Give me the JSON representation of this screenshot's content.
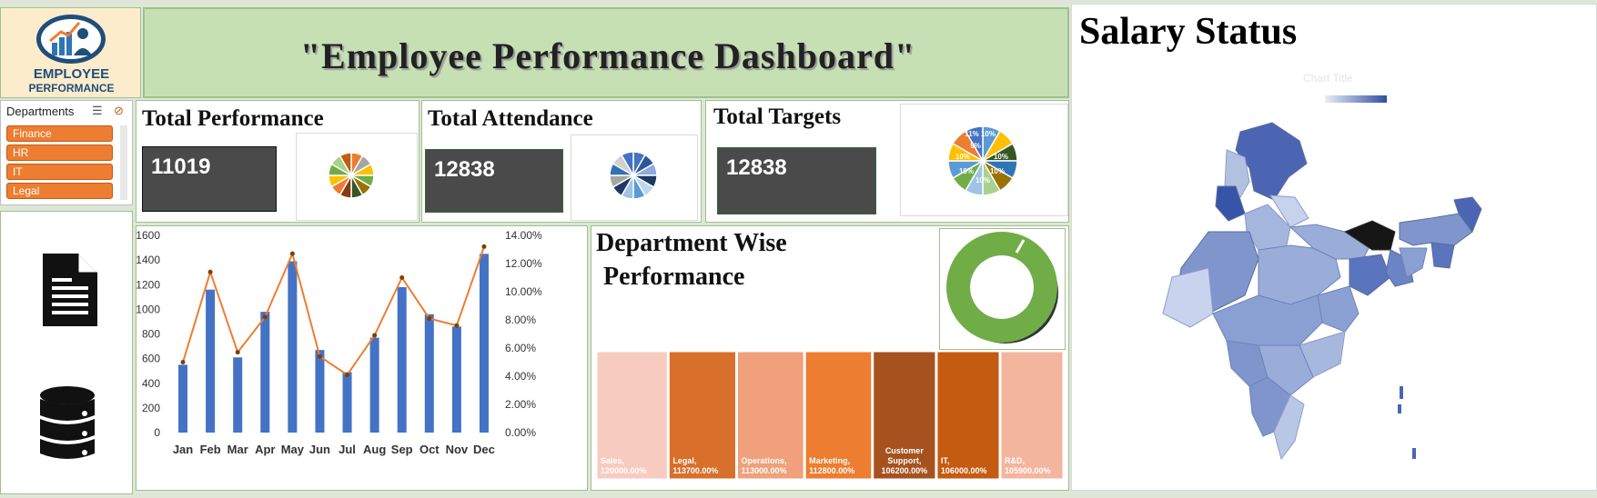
{
  "logo": {
    "line1": "EMPLOYEE",
    "line2": "PERFORMANCE"
  },
  "header": {
    "title": "\"Employee Performance Dashboard\""
  },
  "slicer": {
    "title": "Departments",
    "items": [
      "Finance",
      "HR",
      "IT",
      "Legal"
    ]
  },
  "kpis": {
    "performance": {
      "label": "Total Performance",
      "value": "11019"
    },
    "attendance": {
      "label": "Total Attendance",
      "value": "12838"
    },
    "targets": {
      "label": "Total Targets",
      "value": "12838"
    }
  },
  "targets_pie_labels": [
    "11%",
    "10%",
    "10%",
    "10%",
    "10%",
    "10%",
    "10%",
    "9%"
  ],
  "dept_section": {
    "title_line1": "Department Wise",
    "title_line2": "Performance"
  },
  "salary": {
    "title": "Salary Status",
    "map_chart_title": "Chart Title"
  },
  "side_icons": [
    "document-icon",
    "database-icon"
  ],
  "colors": {
    "accent": "#ed7d31",
    "bar": "#4472c4",
    "line": "#ed7d31",
    "header_bg": "#c6e0b4",
    "kpi_box": "#4a4a4a",
    "donut": "#70ad47"
  },
  "chart_data": [
    {
      "type": "bar",
      "categories": [
        "Jan",
        "Feb",
        "Mar",
        "Apr",
        "May",
        "Jun",
        "Jul",
        "Aug",
        "Sep",
        "Oct",
        "Nov",
        "Dec"
      ],
      "series": [
        {
          "values": [
            550,
            1160,
            610,
            980,
            1390,
            670,
            490,
            770,
            1180,
            960,
            860,
            1450
          ],
          "axis": "left"
        },
        {
          "type": "line",
          "values": [
            5.0,
            11.4,
            5.7,
            8.2,
            12.7,
            5.4,
            4.1,
            6.9,
            11.0,
            8.1,
            7.6,
            13.2
          ],
          "axis": "right"
        }
      ],
      "y_ticks": [
        "0",
        "200",
        "400",
        "600",
        "800",
        "1000",
        "1200",
        "1400",
        "1600"
      ],
      "ylim": [
        0,
        1600
      ],
      "y2_ticks": [
        "0.00%",
        "2.00%",
        "4.00%",
        "6.00%",
        "8.00%",
        "10.00%",
        "12.00%",
        "14.00%"
      ],
      "y2lim": [
        0,
        14
      ]
    },
    {
      "type": "table",
      "categories": [
        "Sales",
        "Legal",
        "Operations",
        "Marketing",
        "Customer Support",
        "IT",
        "R&D"
      ],
      "labels": [
        "Sales,\n120000.00%",
        "Legal,\n113700.00%",
        "Operations,\n113000.00%",
        "Marketing,\n112800.00%",
        "Customer\nSupport,\n106200.00%",
        "IT,\n106000.00%",
        "R&D,\n105900.00%"
      ],
      "values": [
        120000,
        113700,
        113000,
        112800,
        106200,
        106000,
        105900
      ],
      "colors": [
        "#f8cbc0",
        "#d86f2a",
        "#f0a07a",
        "#ed7d31",
        "#a6521f",
        "#c55a11",
        "#f4b59e"
      ]
    }
  ]
}
